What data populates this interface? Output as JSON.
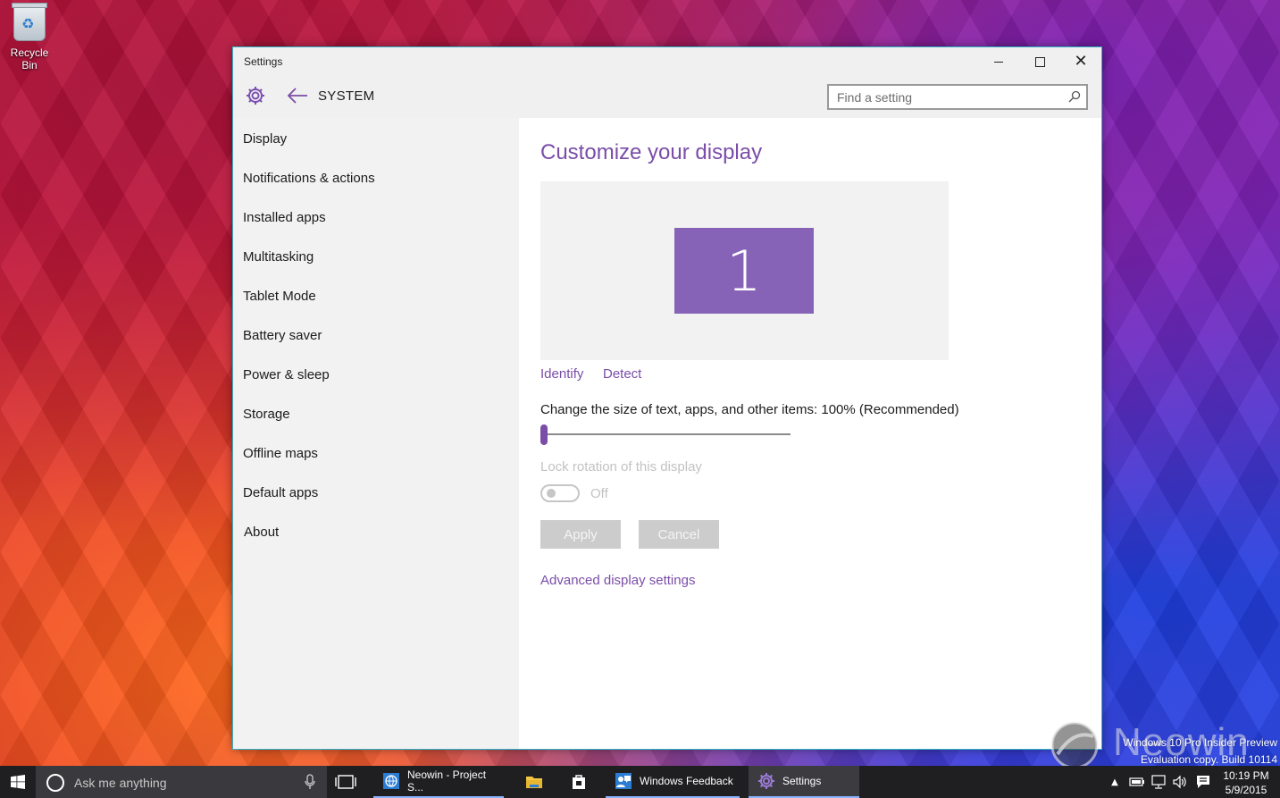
{
  "desktop": {
    "recycle_bin_label": "Recycle Bin",
    "watermark_line1": "Windows 10 Pro Insider Preview",
    "watermark_line2": "Evaluation copy. Build 10114",
    "neowin_logo_text": "Neowin"
  },
  "window": {
    "title": "Settings",
    "accent_color": "#7a4da8",
    "border_color": "#34b3c9"
  },
  "header": {
    "section": "SYSTEM",
    "search_placeholder": "Find a setting",
    "search_value": ""
  },
  "sidebar": {
    "items": [
      {
        "label": "Display"
      },
      {
        "label": "Notifications & actions"
      },
      {
        "label": "Installed apps"
      },
      {
        "label": "Multitasking"
      },
      {
        "label": "Tablet Mode"
      },
      {
        "label": "Battery saver"
      },
      {
        "label": "Power & sleep"
      },
      {
        "label": "Storage"
      },
      {
        "label": "Offline maps"
      },
      {
        "label": "Default apps"
      },
      {
        "label": "About"
      }
    ]
  },
  "main": {
    "title": "Customize your display",
    "monitor_number": "1",
    "identify_label": "Identify",
    "detect_label": "Detect",
    "scale_label": "Change the size of text, apps, and other items: 100% (Recommended)",
    "scale_slider_fraction": 0,
    "lock_rotation_label": "Lock rotation of this display",
    "lock_rotation_state": "Off",
    "apply_label": "Apply",
    "cancel_label": "Cancel",
    "advanced_link": "Advanced display settings"
  },
  "taskbar": {
    "search_placeholder": "Ask me anything",
    "apps": [
      {
        "label": "Neowin - Project S...",
        "icon": "edge-icon"
      },
      {
        "label": "",
        "icon": "file-explorer-icon"
      },
      {
        "label": "",
        "icon": "store-icon"
      },
      {
        "label": "Windows Feedback",
        "icon": "feedback-icon"
      },
      {
        "label": "Settings",
        "icon": "gear-icon"
      }
    ],
    "time": "10:19 PM",
    "date": "5/9/2015"
  }
}
